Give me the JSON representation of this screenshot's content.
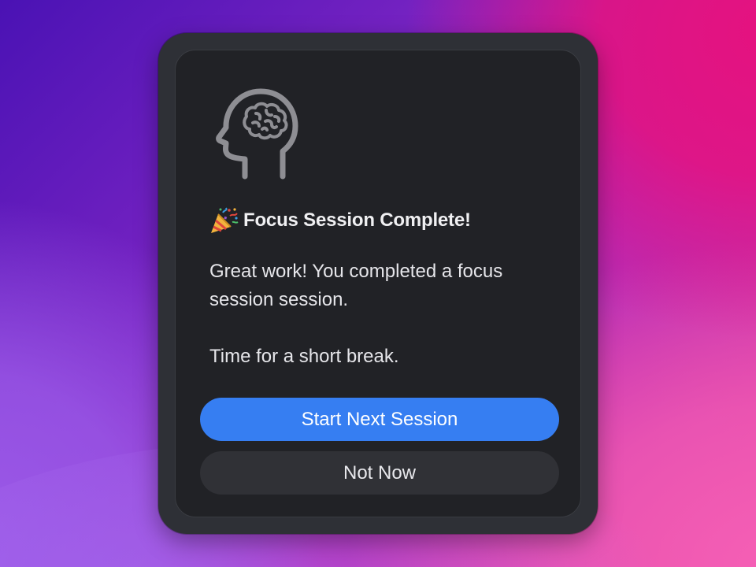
{
  "notification": {
    "app_icon": "head-brain-icon",
    "title_icon": "party-popper-icon",
    "title": "Focus Session Complete!",
    "message_line1": "Great work! You completed a focus session session.",
    "message_line2": "Time for a short break.",
    "primary_button": "Start Next Session",
    "secondary_button": "Not Now"
  },
  "colors": {
    "window_bg": "#2e3036",
    "card_bg": "#212226",
    "primary_button_bg": "#367ef2",
    "secondary_button_bg": "#303136",
    "icon_stroke": "#8e8e93"
  }
}
